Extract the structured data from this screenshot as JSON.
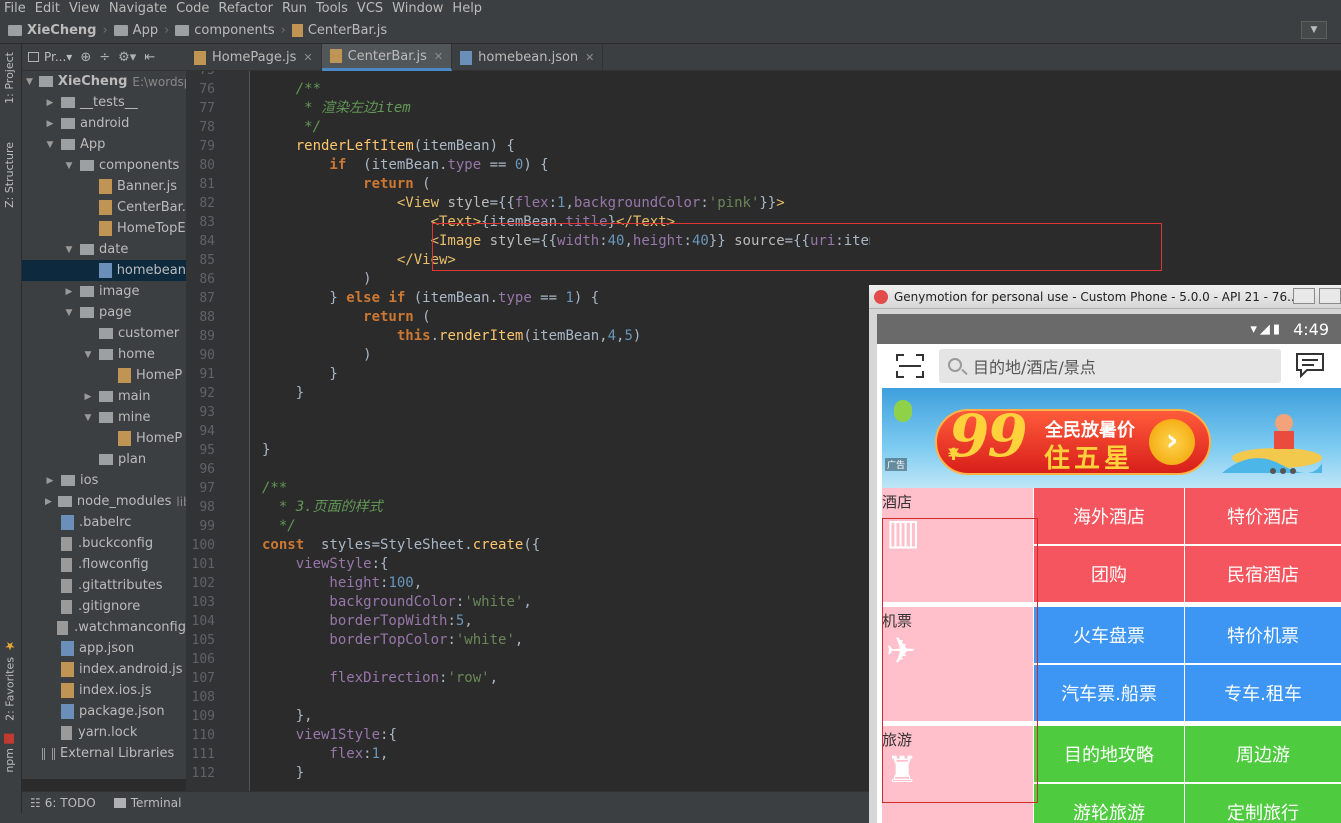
{
  "menu": [
    "File",
    "Edit",
    "View",
    "Navigate",
    "Code",
    "Refactor",
    "Run",
    "Tools",
    "VCS",
    "Window",
    "Help"
  ],
  "breadcrumb": {
    "project": "XieCheng",
    "app": "App",
    "components": "components",
    "file": "CenterBar.js"
  },
  "left_strip": {
    "project_tab": "1: Project",
    "structure_tab": "Z: Structure",
    "favorites_tab": "2: Favorites",
    "npm_tab": "npm"
  },
  "project_toolbar": {
    "label": "Pr...▾"
  },
  "tree": [
    {
      "label": "XieCheng",
      "hint": "E:\\wordsp",
      "type": "folder",
      "indent": 0,
      "arrow": "▼",
      "bold": true
    },
    {
      "label": "__tests__",
      "type": "folder",
      "indent": 1,
      "arrow": "▶"
    },
    {
      "label": "android",
      "type": "folder",
      "indent": 1,
      "arrow": "▶"
    },
    {
      "label": "App",
      "type": "folder",
      "indent": 1,
      "arrow": "▼"
    },
    {
      "label": "components",
      "type": "folder",
      "indent": 2,
      "arrow": "▼"
    },
    {
      "label": "Banner.js",
      "type": "js",
      "indent": 3
    },
    {
      "label": "CenterBar.",
      "type": "js",
      "indent": 3
    },
    {
      "label": "HomeTopE",
      "type": "js",
      "indent": 3
    },
    {
      "label": "date",
      "type": "folder",
      "indent": 2,
      "arrow": "▼"
    },
    {
      "label": "homebean",
      "type": "json",
      "indent": 3,
      "selected": true
    },
    {
      "label": "image",
      "type": "folder",
      "indent": 2,
      "arrow": "▶"
    },
    {
      "label": "page",
      "type": "folder",
      "indent": 2,
      "arrow": "▼"
    },
    {
      "label": "customer",
      "type": "folder",
      "indent": 3
    },
    {
      "label": "home",
      "type": "folder",
      "indent": 3,
      "arrow": "▼"
    },
    {
      "label": "HomeP",
      "type": "js",
      "indent": 4
    },
    {
      "label": "main",
      "type": "folder",
      "indent": 3,
      "arrow": "▶"
    },
    {
      "label": "mine",
      "type": "folder",
      "indent": 3,
      "arrow": "▼"
    },
    {
      "label": "HomeP",
      "type": "js",
      "indent": 4
    },
    {
      "label": "plan",
      "type": "folder",
      "indent": 3
    },
    {
      "label": "ios",
      "type": "folder",
      "indent": 1,
      "arrow": "▶"
    },
    {
      "label": "node_modules",
      "hint": "lib",
      "type": "folder",
      "indent": 1,
      "arrow": "▶"
    },
    {
      "label": ".babelrc",
      "type": "json",
      "indent": 1
    },
    {
      "label": ".buckconfig",
      "type": "file",
      "indent": 1
    },
    {
      "label": ".flowconfig",
      "type": "file",
      "indent": 1
    },
    {
      "label": ".gitattributes",
      "type": "file",
      "indent": 1
    },
    {
      "label": ".gitignore",
      "type": "file",
      "indent": 1
    },
    {
      "label": ".watchmanconfig",
      "type": "file",
      "indent": 1
    },
    {
      "label": "app.json",
      "type": "json",
      "indent": 1
    },
    {
      "label": "index.android.js",
      "type": "js",
      "indent": 1
    },
    {
      "label": "index.ios.js",
      "type": "js",
      "indent": 1
    },
    {
      "label": "package.json",
      "type": "json",
      "indent": 1
    },
    {
      "label": "yarn.lock",
      "type": "file",
      "indent": 1
    },
    {
      "label": "External Libraries",
      "type": "lib",
      "indent": 0
    }
  ],
  "bottom_tabs": {
    "todo": "6: TODO",
    "terminal": "Terminal"
  },
  "editor_tabs": [
    {
      "label": "HomePage.js",
      "kind": "js",
      "active": false
    },
    {
      "label": "CenterBar.js",
      "kind": "js",
      "active": true
    },
    {
      "label": "homebean.json",
      "kind": "json",
      "active": false
    }
  ],
  "line_numbers": [
    "75",
    "76",
    "77",
    "78",
    "79",
    "80",
    "81",
    "82",
    "83",
    "84",
    "85",
    "86",
    "87",
    "88",
    "89",
    "90",
    "91",
    "92",
    "93",
    "94",
    "95",
    "96",
    "97",
    "98",
    "99",
    "100",
    "101",
    "102",
    "103",
    "104",
    "105",
    "106",
    "107",
    "108",
    "109",
    "110",
    "111",
    "112"
  ],
  "code_lines": [
    [],
    [
      [
        "cm",
        "    /**"
      ]
    ],
    [
      [
        "cm",
        "     * 渲染左边item"
      ]
    ],
    [
      [
        "cm",
        "     */"
      ]
    ],
    [
      [
        "fn",
        "    renderLeftItem"
      ],
      [
        "",
        "(itemBean) {"
      ]
    ],
    [
      [
        "kw",
        "        if"
      ],
      [
        "",
        "  (itemBean."
      ],
      [
        "prop",
        "type"
      ],
      [
        "",
        " == "
      ],
      [
        "num",
        "0"
      ],
      [
        "",
        ") {"
      ]
    ],
    [
      [
        "kw",
        "            return"
      ],
      [
        "",
        " ("
      ]
    ],
    [
      [
        "",
        "                "
      ],
      [
        "tag",
        "<View"
      ],
      [
        "attr",
        " style"
      ],
      [
        "",
        "={{"
      ],
      [
        "prop",
        "flex"
      ],
      [
        "",
        ":"
      ],
      [
        "num",
        "1"
      ],
      [
        "",
        ","
      ],
      [
        "prop",
        "backgroundColor"
      ],
      [
        "",
        ":"
      ],
      [
        "str",
        "'pink'"
      ],
      [
        "",
        "}}"
      ],
      [
        "tag",
        ">"
      ]
    ],
    [
      [
        "",
        "                    "
      ],
      [
        "tag",
        "<Text>"
      ],
      [
        "",
        "{itemBean."
      ],
      [
        "prop",
        "title"
      ],
      [
        "",
        "}"
      ],
      [
        "tag",
        "</Text>"
      ]
    ],
    [
      [
        "",
        "                    "
      ],
      [
        "tag",
        "<Image"
      ],
      [
        "attr",
        " style"
      ],
      [
        "",
        "={{"
      ],
      [
        "prop",
        "width"
      ],
      [
        "",
        ":"
      ],
      [
        "num",
        "40"
      ],
      [
        "",
        ","
      ],
      [
        "prop",
        "height"
      ],
      [
        "",
        ":"
      ],
      [
        "num",
        "40"
      ],
      [
        "",
        "}}"
      ],
      [
        "attr",
        " source"
      ],
      [
        "",
        "={{"
      ],
      [
        "prop",
        "uri"
      ],
      [
        "",
        ":itemBean."
      ],
      [
        "prop",
        "imageUrl"
      ],
      [
        "",
        "}}"
      ],
      [
        "tag",
        "></Image>"
      ]
    ],
    [
      [
        "",
        "                "
      ],
      [
        "tag",
        "</View>"
      ]
    ],
    [
      [
        "",
        "            )"
      ]
    ],
    [
      [
        "",
        "        } "
      ],
      [
        "kw",
        "else if"
      ],
      [
        "",
        " (itemBean."
      ],
      [
        "prop",
        "type"
      ],
      [
        "",
        " == "
      ],
      [
        "num",
        "1"
      ],
      [
        "",
        ") {"
      ]
    ],
    [
      [
        "kw",
        "            return"
      ],
      [
        "",
        " ("
      ]
    ],
    [
      [
        "kw",
        "                this"
      ],
      [
        "",
        "."
      ],
      [
        "fn",
        "renderItem"
      ],
      [
        "",
        "(itemBean,"
      ],
      [
        "num",
        "4"
      ],
      [
        "",
        ","
      ],
      [
        "num",
        "5"
      ],
      [
        "",
        ")"
      ]
    ],
    [
      [
        "",
        "            )"
      ]
    ],
    [
      [
        "",
        "        }"
      ]
    ],
    [
      [
        "",
        "    }"
      ]
    ],
    [],
    [],
    [
      [
        "",
        "}"
      ]
    ],
    [],
    [
      [
        "cm",
        "/**"
      ]
    ],
    [
      [
        "cm",
        "  * 3.页面的样式"
      ]
    ],
    [
      [
        "cm",
        "  */"
      ]
    ],
    [
      [
        "kw",
        "const"
      ],
      [
        "",
        "  styles=StyleSheet."
      ],
      [
        "fn",
        "create"
      ],
      [
        "",
        "({"
      ]
    ],
    [
      [
        "prop",
        "    viewStyle"
      ],
      [
        "",
        ":{"
      ]
    ],
    [
      [
        "prop",
        "        height"
      ],
      [
        "",
        ":"
      ],
      [
        "num",
        "100"
      ],
      [
        "",
        ","
      ]
    ],
    [
      [
        "prop",
        "        backgroundColor"
      ],
      [
        "",
        ":"
      ],
      [
        "str",
        "'white'"
      ],
      [
        "",
        ","
      ]
    ],
    [
      [
        "prop",
        "        borderTopWidth"
      ],
      [
        "",
        ":"
      ],
      [
        "num",
        "5"
      ],
      [
        "",
        ","
      ]
    ],
    [
      [
        "prop",
        "        borderTopColor"
      ],
      [
        "",
        ":"
      ],
      [
        "str",
        "'white'"
      ],
      [
        "",
        ","
      ]
    ],
    [],
    [
      [
        "prop",
        "        flexDirection"
      ],
      [
        "",
        ":"
      ],
      [
        "str",
        "'row'"
      ],
      [
        "",
        ","
      ]
    ],
    [],
    [
      [
        "",
        "    },"
      ]
    ],
    [
      [
        "prop",
        "    view1Style"
      ],
      [
        "",
        ":{"
      ]
    ],
    [
      [
        "prop",
        "        flex"
      ],
      [
        "",
        ":"
      ],
      [
        "num",
        "1"
      ],
      [
        "",
        ","
      ]
    ],
    [
      [
        "",
        "    }"
      ]
    ]
  ],
  "genymotion": {
    "title": "Genymotion for personal use - Custom Phone - 5.0.0 - API 21 - 76...",
    "time": "4:49",
    "search_placeholder": "目的地/酒店/景点",
    "banner": {
      "yen": "¥",
      "big": "99",
      "line1": "全民放暑价",
      "line2": "住五星",
      "arrow": "›",
      "ad": "广告"
    },
    "categories": [
      {
        "title": "酒店",
        "color": "#f5555e",
        "cells": [
          "海外酒店",
          "特价酒店",
          "团购",
          "民宿酒店"
        ]
      },
      {
        "title": "机票",
        "color": "#3e96f4",
        "cells": [
          "火车盘票",
          "特价机票",
          "汽车票.船票",
          "专车.租车"
        ]
      },
      {
        "title": "旅游",
        "color": "#4ecb3e",
        "cells": [
          "目的地攻略",
          "周边游",
          "游轮旅游",
          "定制旅行"
        ]
      }
    ]
  }
}
